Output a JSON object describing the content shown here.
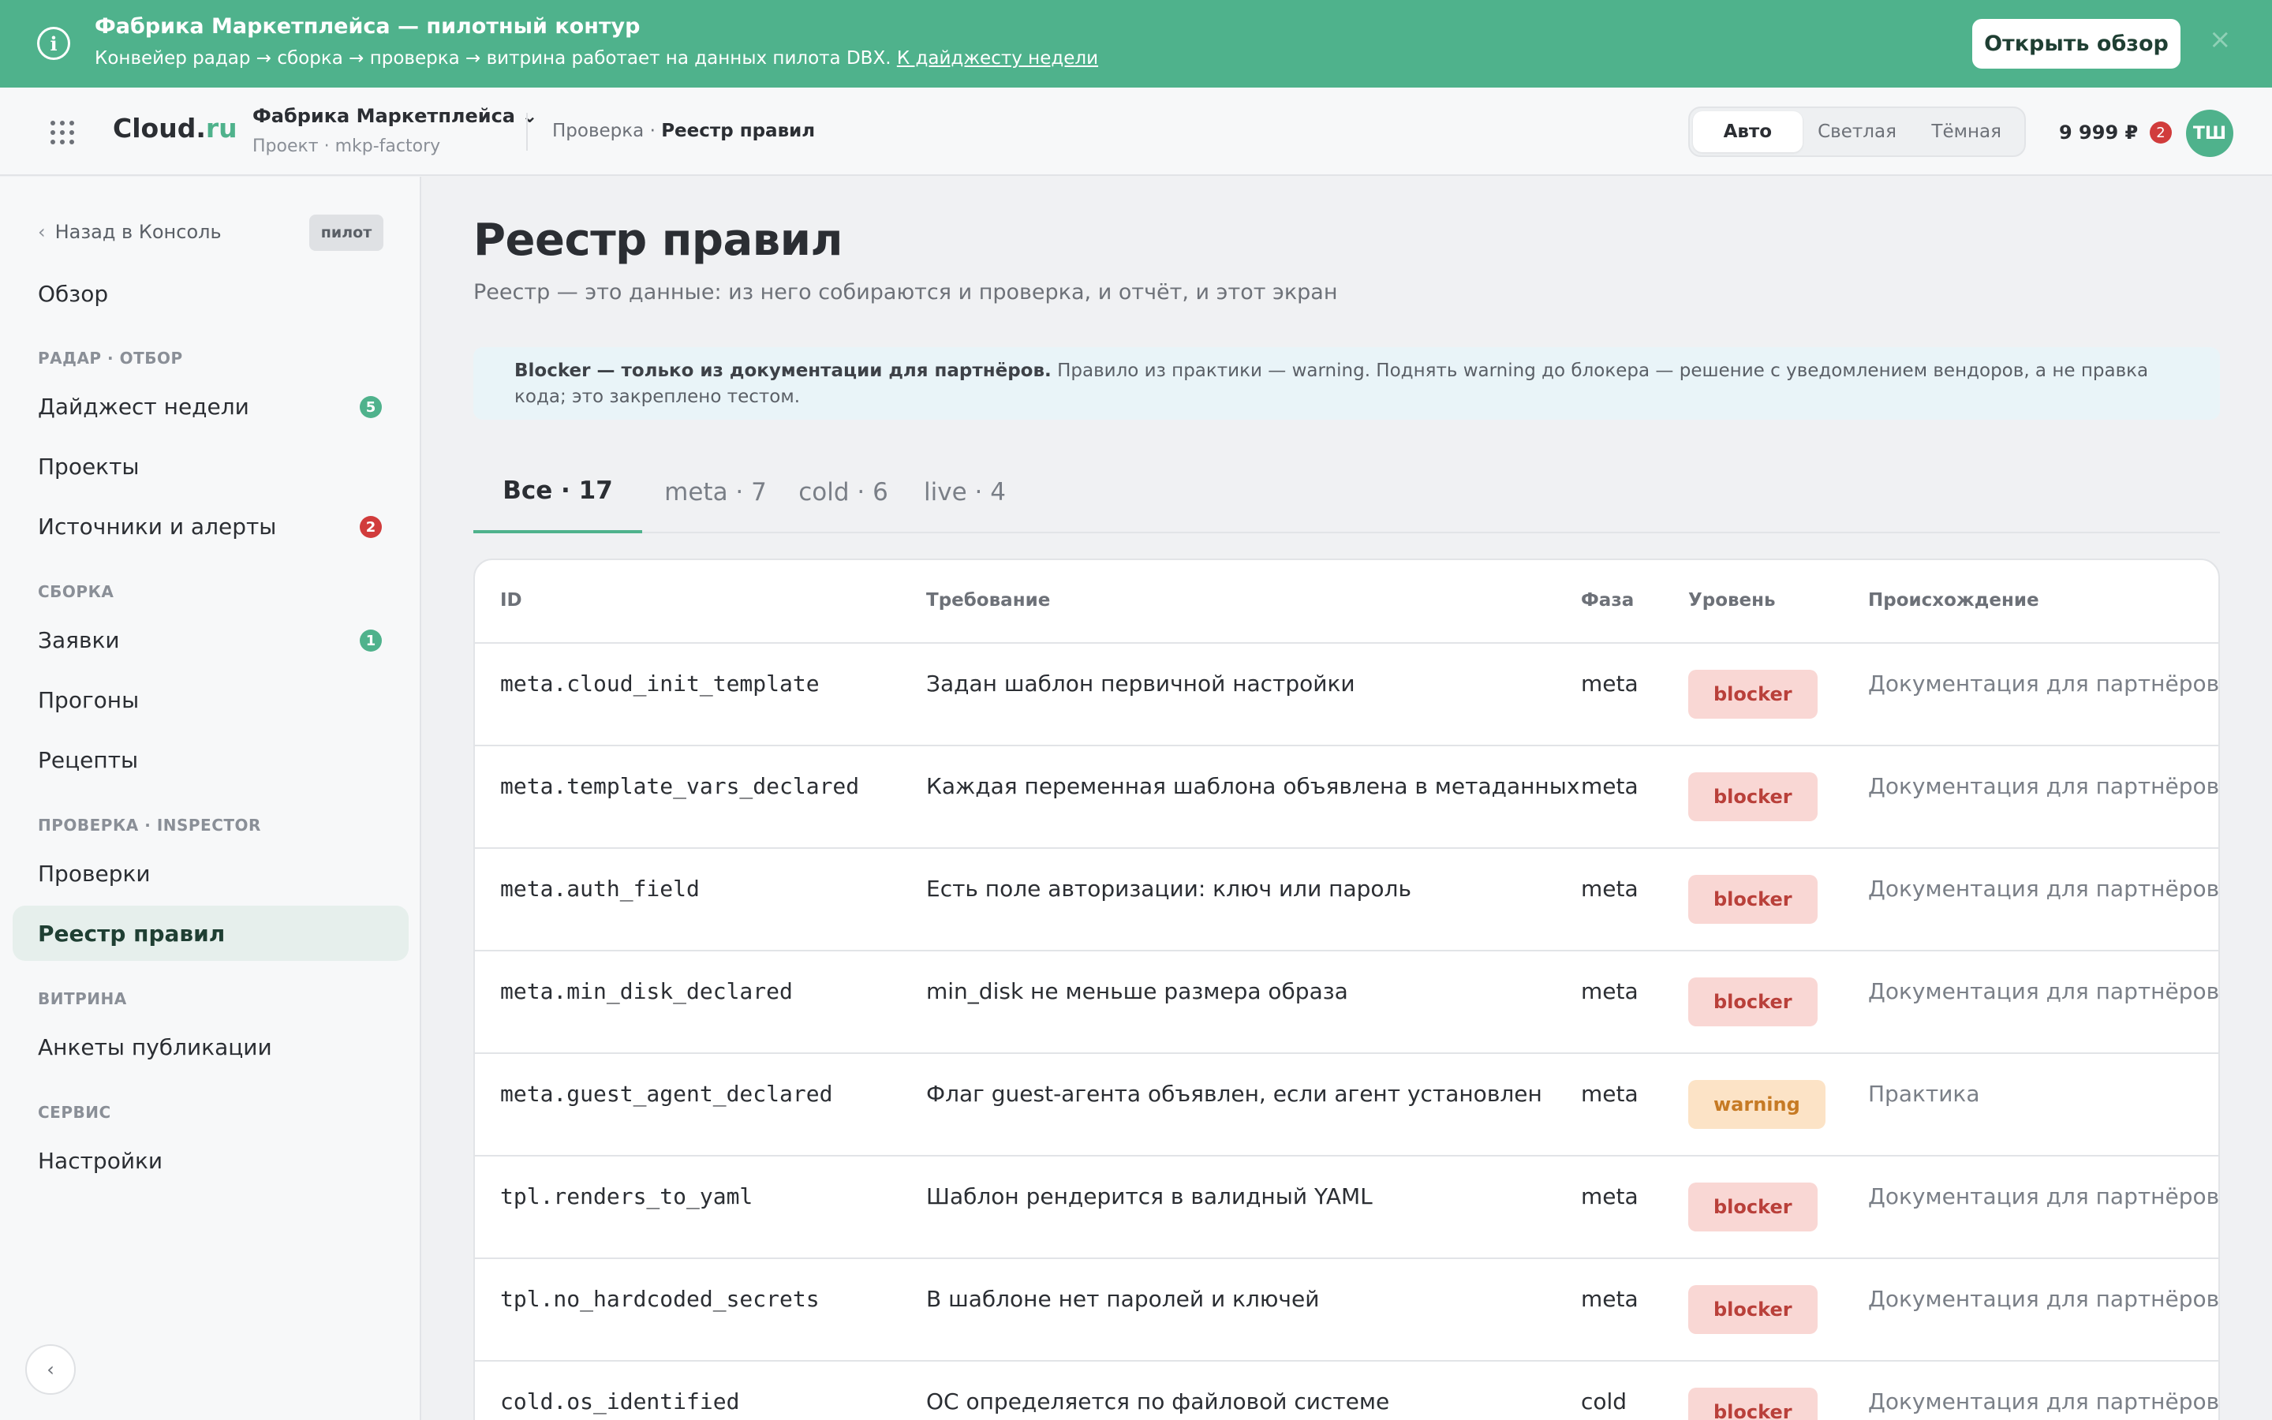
{
  "banner": {
    "title": "Фабрика Маркетплейса — пилотный контур",
    "text": "Конвейер радар → сборка → проверка → витрина работает на данных пилота DBX.",
    "link": "К дайджесту недели",
    "button": "Открыть обзор",
    "close": "×"
  },
  "header": {
    "logo_main": "Cloud.",
    "logo_accent": "ru",
    "project_name": "Фабрика Маркетплейса ⌄",
    "project_sub": "Проект · mkp-factory",
    "breadcrumb_parent": "Проверка · ",
    "breadcrumb_current": "Реестр правил",
    "theme_options": [
      "Авто",
      "Светлая",
      "Тёмная"
    ],
    "theme_active": "Авто",
    "balance": "9 999 ₽",
    "notifications": "2",
    "avatar": "ТШ"
  },
  "sidebar": {
    "back": "Назад в Консоль",
    "back_chevron": "‹",
    "pilot_badge": "пилот",
    "overview": "Обзор",
    "sections": {
      "radar": "Радар · отбор",
      "build": "Сборка",
      "inspect": "Проверка · Inspector",
      "showcase": "Витрина",
      "service": "Сервис"
    },
    "items": {
      "digest": "Дайджест недели",
      "digest_count": "5",
      "projects": "Проекты",
      "sources": "Источники и алерты",
      "sources_count": "2",
      "requests": "Заявки",
      "requests_count": "1",
      "runs": "Прогоны",
      "recipes": "Рецепты",
      "checks": "Проверки",
      "rules": "Реестр правил",
      "forms": "Анкеты публикации",
      "settings": "Настройки"
    },
    "collapse": "‹"
  },
  "main": {
    "title": "Реестр правил",
    "subtitle": "Реестр — это данные: из него собираются и проверка, и отчёт, и этот экран",
    "note_bold": "Blocker — только из документации для партнёров.",
    "note_text": " Правило из практики — warning. Поднять warning до блокера — решение с уведомлением вендоров, а не правка кода; это закреплено тестом.",
    "tabs": [
      "Все · 17",
      "meta · 7",
      "cold · 6",
      "live · 4"
    ],
    "table": {
      "headers": [
        "ID",
        "Требование",
        "Фаза",
        "Уровень",
        "Происхождение"
      ],
      "rows": [
        {
          "id": "meta.cloud_init_template",
          "req": "Задан шаблон первичной настройки",
          "phase": "meta",
          "level": "blocker",
          "origin": "Документация для партнёров"
        },
        {
          "id": "meta.template_vars_declared",
          "req": "Каждая переменная шаблона объявлена в метаданных",
          "phase": "meta",
          "level": "blocker",
          "origin": "Документация для партнёров"
        },
        {
          "id": "meta.auth_field",
          "req": "Есть поле авторизации: ключ или пароль",
          "phase": "meta",
          "level": "blocker",
          "origin": "Документация для партнёров"
        },
        {
          "id": "meta.min_disk_declared",
          "req": "min_disk не меньше размера образа",
          "phase": "meta",
          "level": "blocker",
          "origin": "Документация для партнёров"
        },
        {
          "id": "meta.guest_agent_declared",
          "req": "Флаг guest-агента объявлен, если агент установлен",
          "phase": "meta",
          "level": "warning",
          "origin": "Практика"
        },
        {
          "id": "tpl.renders_to_yaml",
          "req": "Шаблон рендерится в валидный YAML",
          "phase": "meta",
          "level": "blocker",
          "origin": "Документация для партнёров"
        },
        {
          "id": "tpl.no_hardcoded_secrets",
          "req": "В шаблоне нет паролей и ключей",
          "phase": "meta",
          "level": "blocker",
          "origin": "Документация для партнёров"
        },
        {
          "id": "cold.os_identified",
          "req": "ОС определяется по файловой системе",
          "phase": "cold",
          "level": "blocker",
          "origin": "Документация для партнёров"
        }
      ]
    }
  },
  "colors": {
    "accent": "#4fb28c",
    "badge_red": "#d13c3c",
    "blocker_bg": "#f9d7d4",
    "warning_bg": "#fce3c6"
  }
}
